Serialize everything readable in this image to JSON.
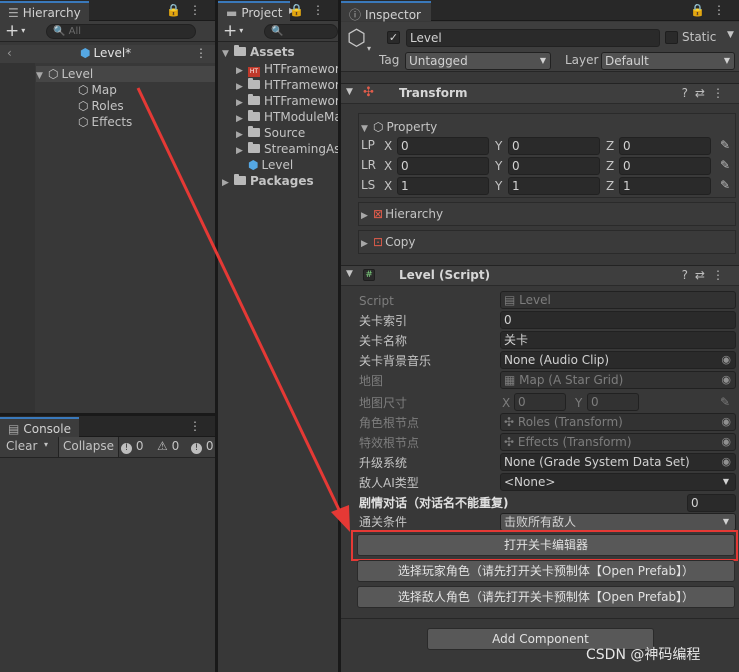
{
  "hierarchy": {
    "tab_label": "Hierarchy",
    "search_placeholder": "All",
    "scene_name": "Level*",
    "items": [
      {
        "label": "Level"
      },
      {
        "label": "Map"
      },
      {
        "label": "Roles"
      },
      {
        "label": "Effects"
      }
    ]
  },
  "console": {
    "tab_label": "Console",
    "clear_label": "Clear",
    "collapse_label": "Collapse",
    "log_count": "0",
    "warn_count": "0",
    "error_count": "0"
  },
  "project": {
    "tab_label": "Project",
    "assets_label": "Assets",
    "packages_label": "Packages",
    "folders": [
      {
        "label": "HTFramework"
      },
      {
        "label": "HTFramewor"
      },
      {
        "label": "HTFramewor"
      },
      {
        "label": "HTModuleMa"
      },
      {
        "label": "Source"
      },
      {
        "label": "StreamingAs"
      }
    ],
    "scene_item": "Level"
  },
  "inspector": {
    "tab_label": "Inspector",
    "object_name": "Level",
    "static_label": "Static",
    "tag_label": "Tag",
    "tag_value": "Untagged",
    "layer_label": "Layer",
    "layer_value": "Default",
    "transform": {
      "title": "Transform",
      "property_label": "Property",
      "lp_label": "LP",
      "lr_label": "LR",
      "ls_label": "LS",
      "x_label": "X",
      "y_label": "Y",
      "z_label": "Z",
      "lp": [
        "0",
        "0",
        "0"
      ],
      "lr": [
        "0",
        "0",
        "0"
      ],
      "ls": [
        "1",
        "1",
        "1"
      ],
      "hierarchy_label": "Hierarchy",
      "copy_label": "Copy"
    },
    "script": {
      "title": "Level (Script)",
      "script_label": "Script",
      "script_value": "Level",
      "fields": [
        {
          "label": "关卡索引",
          "value": "0"
        },
        {
          "label": "关卡名称",
          "value": "关卡"
        },
        {
          "label": "关卡背景音乐",
          "value": "None (Audio Clip)"
        },
        {
          "label": "地图",
          "value": "Map (A Star Grid)"
        },
        {
          "label": "地图尺寸",
          "x": "0",
          "y": "0"
        },
        {
          "label": "角色根节点",
          "value": "Roles (Transform)"
        },
        {
          "label": "特效根节点",
          "value": "Effects (Transform)"
        },
        {
          "label": "升级系统",
          "value": "None (Grade System Data Set)"
        },
        {
          "label": "敌人AI类型",
          "value": "<None>"
        }
      ],
      "dialog_label": "剧情对话（对话名不能重复)",
      "dialog_count": "0",
      "pass_label": "通关条件",
      "pass_value": "击败所有敌人",
      "open_editor_button": "打开关卡编辑器",
      "select_player_button": "选择玩家角色（请先打开关卡预制体【Open Prefab】）",
      "select_enemy_button": "选择敌人角色（请先打开关卡预制体【Open Prefab】）"
    },
    "add_component_button": "Add Component"
  },
  "watermark": "CSDN @神码编程",
  "colors": {
    "annotation_red": "#e53935",
    "tab_accent": "#3a79bb"
  }
}
